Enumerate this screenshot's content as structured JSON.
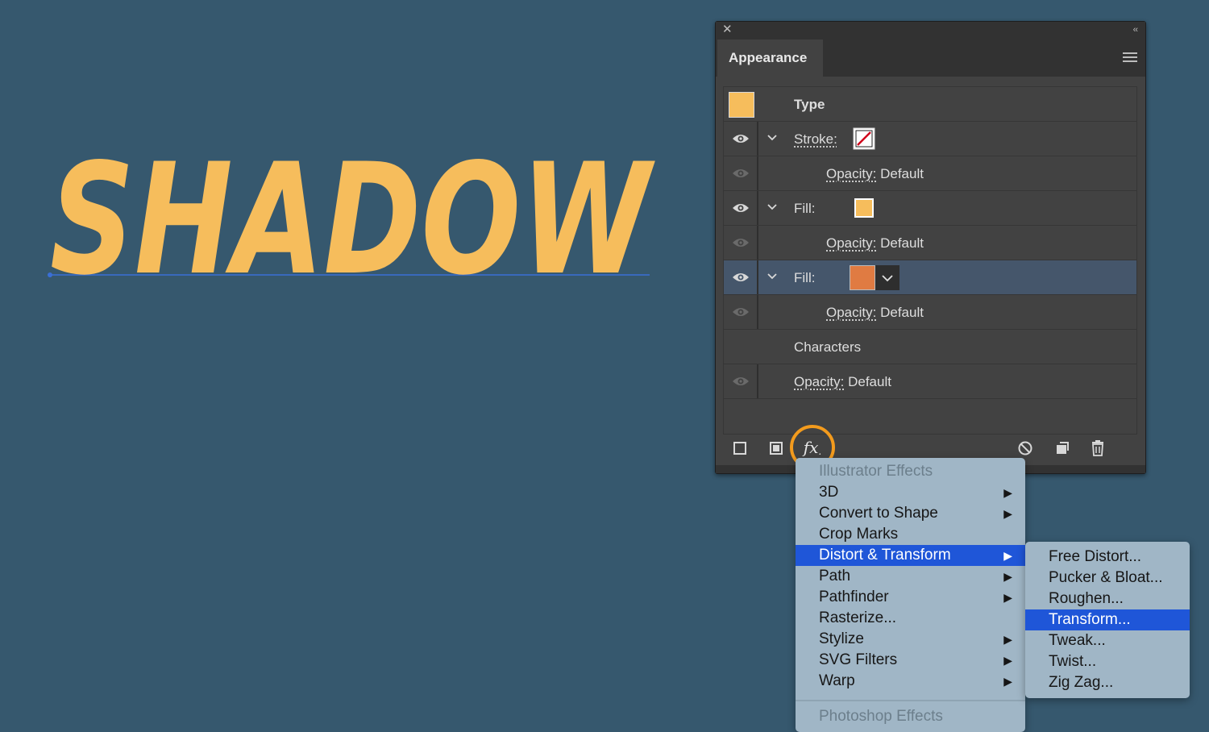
{
  "artwork": {
    "text": "SHADOW",
    "color": "#f6bd5c",
    "baseline_color": "#3a6fd6"
  },
  "panel": {
    "title": "Appearance",
    "rows": [
      {
        "label": "Type",
        "swatch": "#f6bd5c"
      },
      {
        "label": "Stroke:",
        "swatch": "none"
      },
      {
        "label": "Opacity:",
        "value": "Default"
      },
      {
        "label": "Fill:",
        "swatch": "#f6bd5c"
      },
      {
        "label": "Opacity:",
        "value": "Default"
      },
      {
        "label": "Fill:",
        "swatch": "#e07b42",
        "selected": true
      },
      {
        "label": "Opacity:",
        "value": "Default"
      },
      {
        "label": "Characters"
      },
      {
        "label": "Opacity:",
        "value": "Default"
      }
    ],
    "fx_label": "fx",
    "accent": "#f39b1d"
  },
  "effects_menu": {
    "header": "Illustrator Effects",
    "items": [
      {
        "label": "3D",
        "submenu": true
      },
      {
        "label": "Convert to Shape",
        "submenu": true
      },
      {
        "label": "Crop Marks",
        "submenu": false
      },
      {
        "label": "Distort & Transform",
        "submenu": true,
        "highlighted": true
      },
      {
        "label": "Path",
        "submenu": true
      },
      {
        "label": "Pathfinder",
        "submenu": true
      },
      {
        "label": "Rasterize...",
        "submenu": false
      },
      {
        "label": "Stylize",
        "submenu": true
      },
      {
        "label": "SVG Filters",
        "submenu": true
      },
      {
        "label": "Warp",
        "submenu": true
      }
    ],
    "footer": "Photoshop Effects"
  },
  "distort_submenu": {
    "items": [
      {
        "label": "Free Distort..."
      },
      {
        "label": "Pucker & Bloat..."
      },
      {
        "label": "Roughen..."
      },
      {
        "label": "Transform...",
        "highlighted": true
      },
      {
        "label": "Tweak..."
      },
      {
        "label": "Twist..."
      },
      {
        "label": "Zig Zag..."
      }
    ]
  }
}
